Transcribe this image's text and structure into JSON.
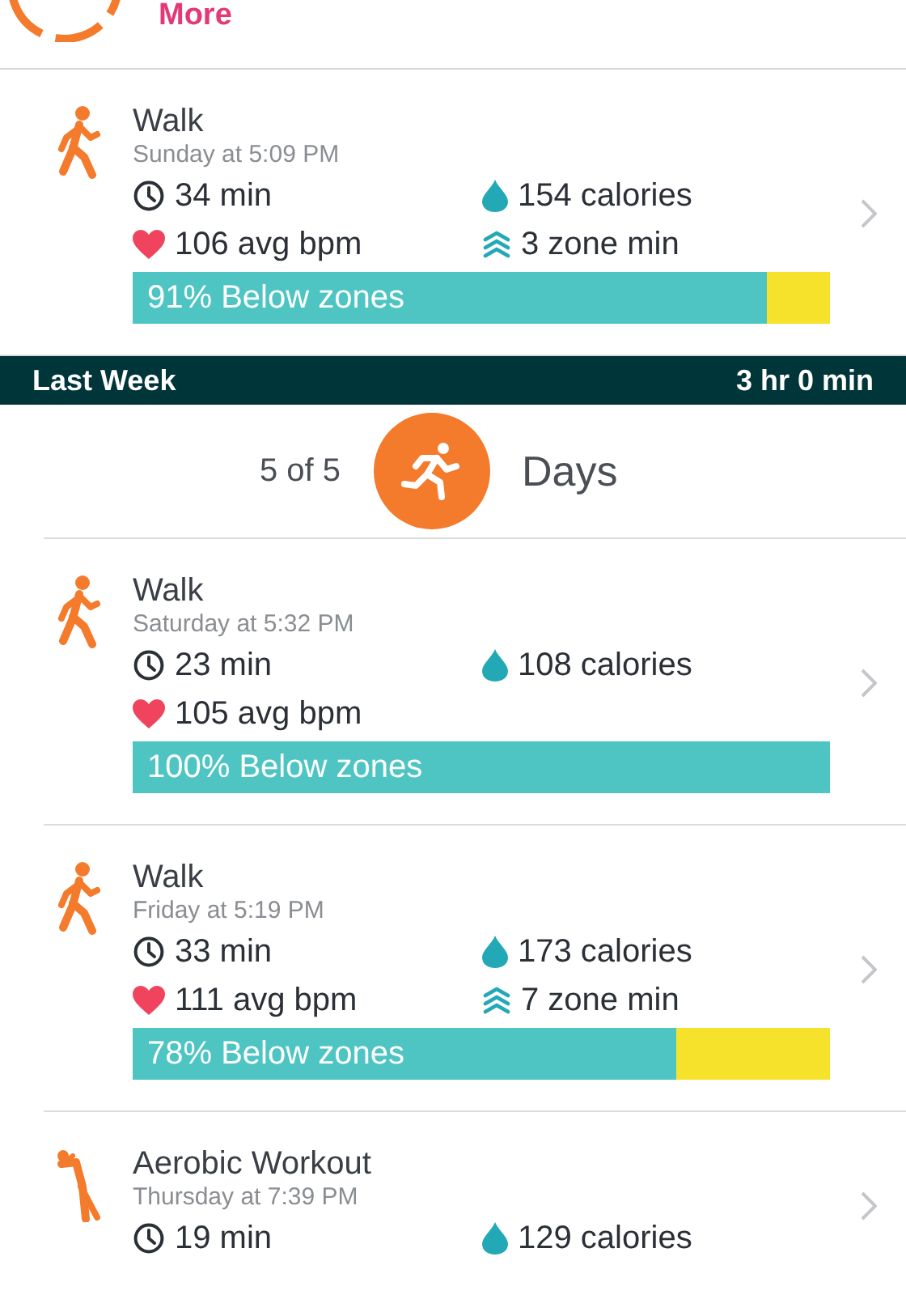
{
  "top": {
    "link": "More"
  },
  "activities": [
    {
      "kind": "walk",
      "name": "Walk",
      "when": "Sunday at 5:09 PM",
      "duration": "34 min",
      "calories": "154 calories",
      "bpm": "106 avg bpm",
      "zone_min": "3 zone min",
      "zones": {
        "label": "91% Below zones",
        "level": 0.91
      }
    },
    {
      "kind": "week",
      "title": "Last Week",
      "total": "3 hr 0 min",
      "count": "5 of 5",
      "unit": "Days"
    },
    {
      "kind": "walk",
      "name": "Walk",
      "when": "Saturday at 5:32 PM",
      "duration": "23 min",
      "calories": "108 calories",
      "bpm": "105 avg bpm",
      "zones": {
        "label": "100% Below zones",
        "level": 1
      }
    },
    {
      "kind": "walk",
      "name": "Walk",
      "when": "Friday at 5:19 PM",
      "duration": "33 min",
      "calories": "173 calories",
      "bpm": "111 avg bpm",
      "zone_min": "7 zone min",
      "zones": {
        "label": "78% Below zones",
        "level": 0.78
      }
    },
    {
      "kind": "aerobic",
      "name": "Aerobic Workout",
      "when": "Thursday at 7:39 PM",
      "duration": "19 min",
      "calories": "129 calories"
    }
  ]
}
